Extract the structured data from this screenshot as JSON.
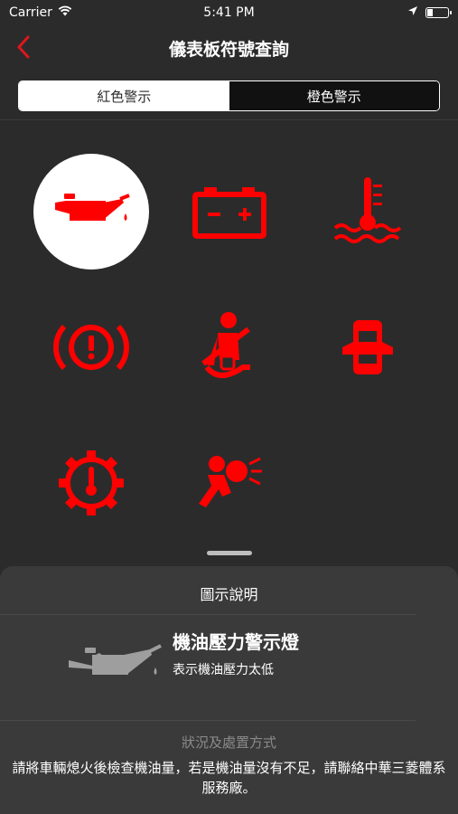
{
  "status_bar": {
    "carrier": "Carrier",
    "time": "5:41 PM"
  },
  "nav": {
    "title": "儀表板符號查詢",
    "back_icon": "chevron-left-icon"
  },
  "tabs": [
    {
      "label": "紅色警示",
      "active": true
    },
    {
      "label": "橙色警示",
      "active": false
    }
  ],
  "colors": {
    "warning_red": "#ff0000",
    "background": "#2b2b2b",
    "sheet": "#3a3a3a",
    "icon_gray": "#9e9e9e"
  },
  "icons": [
    {
      "name": "oil-pressure-icon",
      "selected": true
    },
    {
      "name": "battery-icon",
      "selected": false
    },
    {
      "name": "coolant-temperature-icon",
      "selected": false
    },
    {
      "name": "brake-warning-icon",
      "selected": false
    },
    {
      "name": "seatbelt-icon",
      "selected": false
    },
    {
      "name": "door-open-icon",
      "selected": false
    },
    {
      "name": "transmission-temperature-icon",
      "selected": false
    },
    {
      "name": "airbag-icon",
      "selected": false
    }
  ],
  "sheet": {
    "title": "圖示說明",
    "item_title": "機油壓力警示燈",
    "item_desc": "表示機油壓力太低",
    "section_title": "狀況及處置方式",
    "section_text": "請將車輛熄火後檢查機油量，若是機油量沒有不足，請聯絡中華三菱體系服務廠。"
  }
}
